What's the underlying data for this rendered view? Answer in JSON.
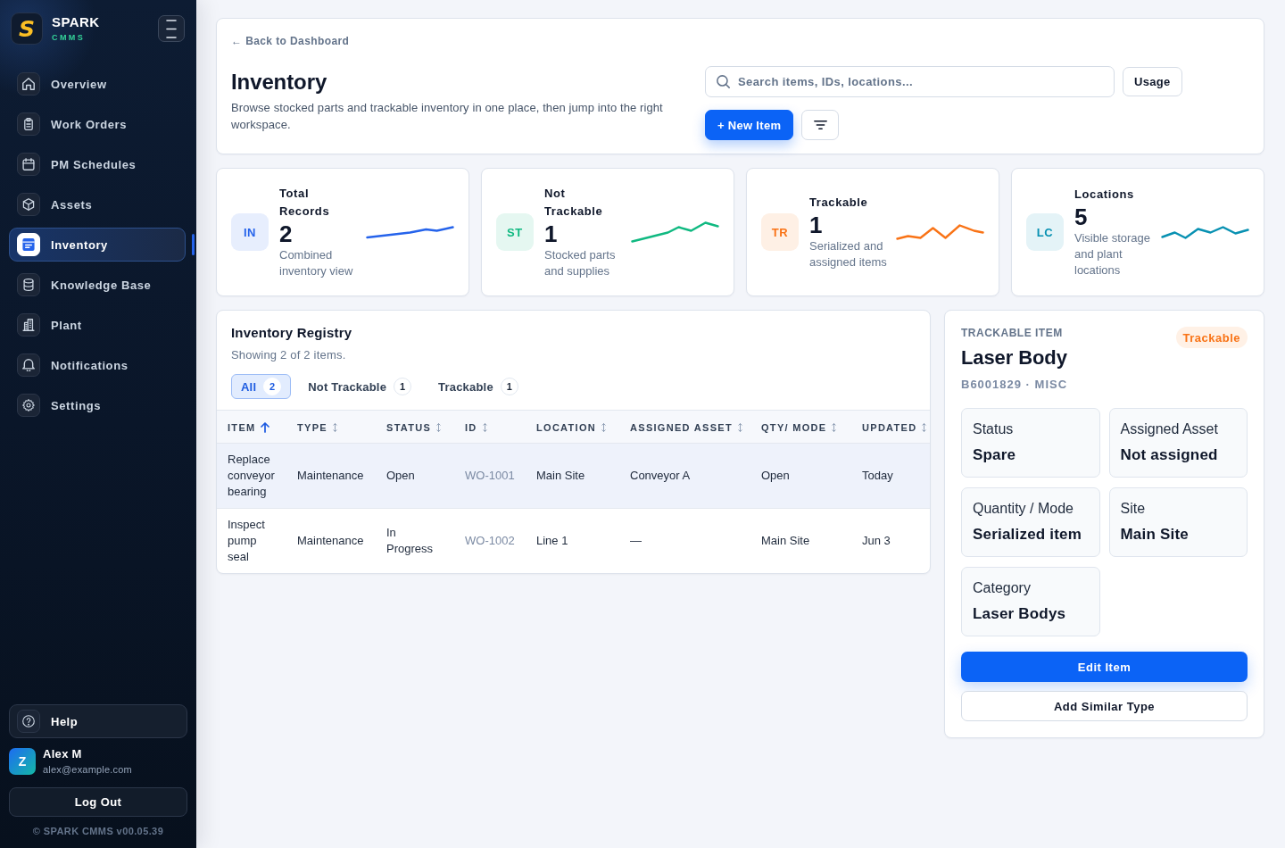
{
  "sidebar": {
    "logo_mark": "S",
    "brand": "SPARK",
    "brand_sub": "CMMS",
    "items": [
      {
        "label": "Overview",
        "selected": false
      },
      {
        "label": "Work Orders",
        "selected": false
      },
      {
        "label": "PM Schedules",
        "selected": false
      },
      {
        "label": "Assets",
        "selected": false
      },
      {
        "label": "Inventory",
        "selected": true
      },
      {
        "label": "Knowledge Base",
        "selected": false
      },
      {
        "label": "Plant",
        "selected": false
      },
      {
        "label": "Notifications",
        "selected": false
      },
      {
        "label": "Settings",
        "selected": false
      }
    ],
    "help": "Help",
    "user": {
      "initial": "Z",
      "name": "Alex M",
      "email": "alex@example.com"
    },
    "logout": "Log Out",
    "version": "© SPARK CMMS v00.05.39"
  },
  "header": {
    "back_link": "← Back to Dashboard",
    "title": "Inventory",
    "description": "Browse stocked parts and trackable inventory in one place, then jump into the right workspace.",
    "search": {
      "placeholder": "Search items, IDs, locations..."
    },
    "usage_button": "Usage",
    "new_item_button": "+ New Item"
  },
  "stats": [
    {
      "badge": "IN",
      "title": "Total Records",
      "value": "2",
      "caption": "Combined inventory view",
      "color": "#2563eb"
    },
    {
      "badge": "ST",
      "title": "Not Trackable",
      "value": "1",
      "caption": "Stocked parts and supplies",
      "color": "#10b981"
    },
    {
      "badge": "TR",
      "title": "Trackable",
      "value": "1",
      "caption": "Serialized and assigned items",
      "color": "#f97316"
    },
    {
      "badge": "LC",
      "title": "Locations",
      "value": "5",
      "caption": "Visible storage and plant locations",
      "color": "#0891b2"
    }
  ],
  "registry": {
    "title": "Inventory Registry",
    "summary": "Showing 2 of 2 items.",
    "filters": [
      {
        "label": "All",
        "count": "2",
        "selected": true
      },
      {
        "label": "Not Trackable",
        "count": "1",
        "selected": false
      },
      {
        "label": "Trackable",
        "count": "1",
        "selected": false
      }
    ],
    "columns": [
      {
        "label": "ITEM",
        "kind": "text",
        "sorted": true
      },
      {
        "label": "TYPE",
        "kind": "text",
        "sorted": false
      },
      {
        "label": "STATUS",
        "kind": "text",
        "sorted": false
      },
      {
        "label": "ID",
        "kind": "id",
        "sorted": false
      },
      {
        "label": "LOCATION",
        "kind": "text",
        "sorted": false
      },
      {
        "label": "ASSIGNED ASSET",
        "kind": "text",
        "sorted": false
      },
      {
        "label": "QTY/ MODE",
        "kind": "text",
        "sorted": false
      },
      {
        "label": "UPDATED",
        "kind": "text",
        "sorted": false
      }
    ],
    "rows": [
      {
        "selected": true,
        "cells": [
          "Replace conveyor bearing",
          "Maintenance",
          "Open",
          "WO-1001",
          "Main Site",
          "Conveyor A",
          "Open",
          "Today"
        ]
      },
      {
        "selected": false,
        "cells": [
          "Inspect pump seal",
          "Maintenance",
          "In Progress",
          "WO-1002",
          "Line 1",
          "—",
          "Main Site",
          "Jun 3"
        ]
      }
    ]
  },
  "detail": {
    "eyebrow": "TRACKABLE ITEM",
    "title": "Laser Body",
    "badge": "Trackable",
    "meta": "B6001829 · MISC",
    "fields": [
      {
        "label": "Status",
        "value": "Spare"
      },
      {
        "label": "Assigned Asset",
        "value": "Not assigned"
      },
      {
        "label": "Quantity / Mode",
        "value": "Serialized item"
      },
      {
        "label": "Site",
        "value": "Main Site"
      },
      {
        "label": "Category",
        "value": "Laser Bodys"
      }
    ],
    "actions": [
      {
        "label": "Edit Item",
        "kind": "primary"
      },
      {
        "label": "Add Similar Type",
        "kind": "secondary"
      }
    ]
  }
}
